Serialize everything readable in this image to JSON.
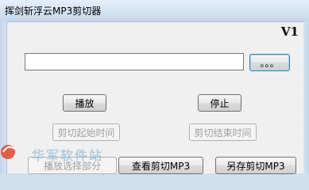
{
  "window": {
    "title": "挥剑斩浮云MP3剪切器"
  },
  "header": {
    "version": "V1"
  },
  "file": {
    "path_value": "",
    "browse_label": "。。。"
  },
  "controls": {
    "play_label": "播放",
    "stop_label": "停止",
    "cut_start_label": "剪切起始时间",
    "cut_end_label": "剪切结束时间",
    "play_selection_label": "播放选择部分",
    "preview_cut_label": "查看剪切MP3",
    "save_cut_label": "另存剪切MP3"
  },
  "watermark": {
    "text": "华军软件站",
    "logo_icon": "site-logo-icon",
    "logo_color": "#e2462b"
  }
}
